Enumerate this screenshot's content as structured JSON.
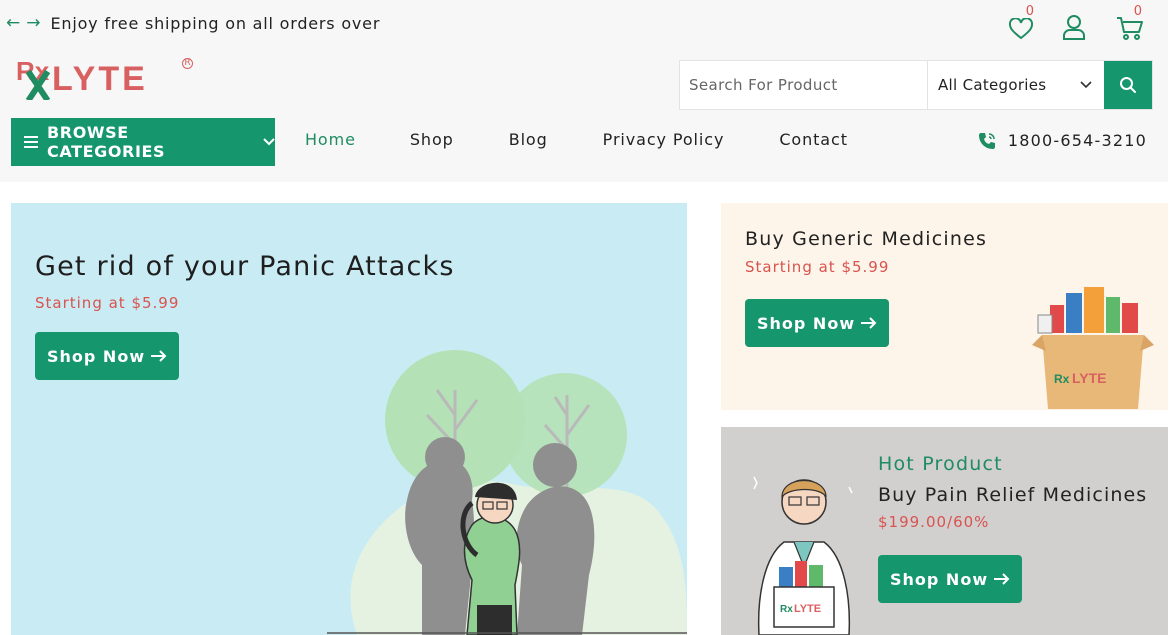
{
  "topbar": {
    "promo": "Enjoy free shipping on all orders over",
    "prev_arrow": "←",
    "next_arrow": "→"
  },
  "header_icons": {
    "wishlist_count": "0",
    "cart_count": "0",
    "icons": [
      "heart-icon",
      "user-icon",
      "cart-icon"
    ]
  },
  "logo": {
    "text": "LYTE",
    "rx": "Rx",
    "reg": "R"
  },
  "search": {
    "placeholder": "Search For Product",
    "category": "All Categories"
  },
  "browse": {
    "label": "BROWSE CATEGORIES"
  },
  "nav": {
    "items": [
      "Home",
      "Shop",
      "Blog",
      "Privacy Policy",
      "Contact"
    ],
    "active": "Home"
  },
  "phone": {
    "number": "1800-654-3210"
  },
  "hero": {
    "title": "Get rid of your Panic Attacks",
    "price": "Starting at $5.99",
    "button": "Shop Now"
  },
  "promo_generic": {
    "title": "Buy Generic Medicines",
    "price": "Starting at $5.99",
    "button": "Shop Now",
    "box_logo": "LYTE"
  },
  "promo_pain": {
    "tag": "Hot Product",
    "title": "Buy Pain Relief Medicines",
    "price": "$199.00/60%",
    "button": "Shop Now",
    "box_logo": "LYTE"
  },
  "colors": {
    "brand_green": "#16966d",
    "accent_red": "#d9534f",
    "logo_red": "#d96060"
  }
}
